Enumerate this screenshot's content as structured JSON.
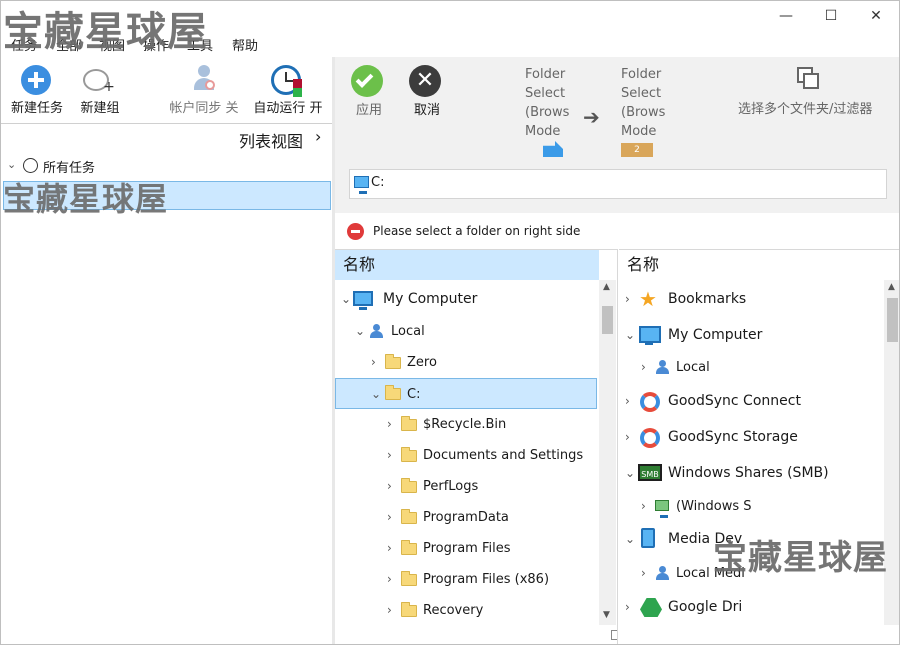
{
  "watermark": "宝藏星球屋",
  "window": {
    "min": "—",
    "max": "☐",
    "close": "✕"
  },
  "menu": [
    "任务",
    "全部",
    "视图",
    "操作",
    "工具",
    "帮助"
  ],
  "left_toolbar": {
    "new_task": "新建任务",
    "new_group": "新建组",
    "account_sync": "帐户同步 关",
    "auto_run": "自动运行 开"
  },
  "left_pane": {
    "view_label": "列表视图",
    "view_chevron": "›",
    "all_tasks": "所有任务"
  },
  "right_toolbar": {
    "apply": "应用",
    "cancel": "取消",
    "folder_select_1": [
      "Folder",
      "Select",
      "(Brows",
      "Mode",
      "."
    ],
    "folder_select_2": [
      "Folder",
      "Select",
      "(Brows",
      "Mode"
    ],
    "folder_badge": "2",
    "multi_select": "选择多个文件夹/过滤器"
  },
  "address": {
    "value": "C:"
  },
  "message": "Please select a folder on right side",
  "left_tree": {
    "header": "名称",
    "items": [
      {
        "label": "My Computer"
      },
      {
        "label": "Local"
      },
      {
        "label": "Zero"
      },
      {
        "label": "C:"
      },
      {
        "label": "$Recycle.Bin"
      },
      {
        "label": "Documents and Settings"
      },
      {
        "label": "PerfLogs"
      },
      {
        "label": "ProgramData"
      },
      {
        "label": "Program Files"
      },
      {
        "label": "Program Files (x86)"
      },
      {
        "label": "Recovery"
      }
    ]
  },
  "right_tree": {
    "header": "名称",
    "items": [
      {
        "label": "Bookmarks"
      },
      {
        "label": "My Computer"
      },
      {
        "label": "Local"
      },
      {
        "label": "GoodSync Connect"
      },
      {
        "label": "GoodSync Storage"
      },
      {
        "label": "Windows Shares (SMB)"
      },
      {
        "label": "(Windows S"
      },
      {
        "label": "Media Dev"
      },
      {
        "label": "Local Medi"
      },
      {
        "label": "Google Dri"
      }
    ],
    "smb_icon_text": "SMB"
  },
  "colors": {
    "selection": "#cce8ff",
    "selection_border": "#7ab8e6",
    "accent_blue": "#1f6fb5",
    "apply_green": "#6cc04a",
    "cancel_dark": "#3c3c3c",
    "error_red": "#e03a3a"
  }
}
